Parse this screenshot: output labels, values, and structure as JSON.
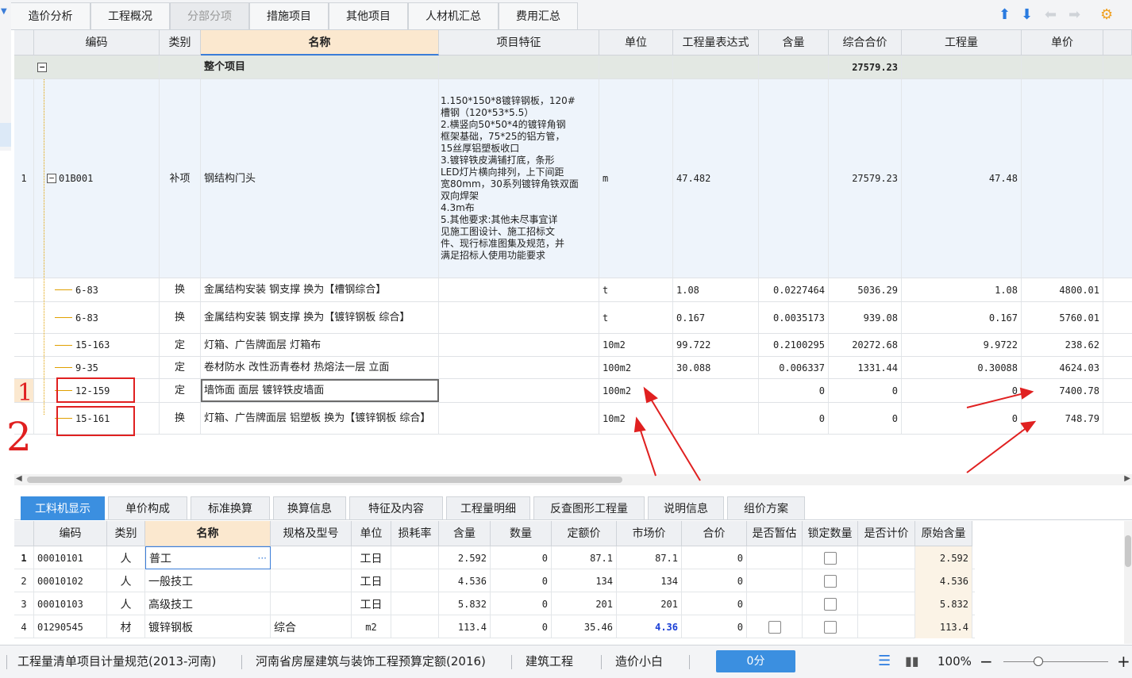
{
  "top_tabs": [
    "造价分析",
    "工程概况",
    "分部分项",
    "措施项目",
    "其他项目",
    "人材机汇总",
    "费用汇总"
  ],
  "active_top_tab": "分部分项",
  "toolbar_icons": [
    "arrow-up-icon",
    "arrow-down-icon",
    "arrow-left-icon",
    "arrow-right-icon",
    "settings-icon"
  ],
  "grid": {
    "headers": [
      "编码",
      "类别",
      "名称",
      "项目特征",
      "单位",
      "工程量表达式",
      "含量",
      "综合合价",
      "工程量",
      "单价"
    ],
    "total_row": {
      "name": "整个项目",
      "combined_total": "27579.23"
    },
    "item_row": {
      "index": "1",
      "code": "01B001",
      "category": "补项",
      "name": "钢结构门头",
      "features": "1.150*150*8镀锌钢板，120#\n槽钢（120*53*5.5）\n2.横竖向50*50*4的镀锌角钢\n框架基础，75*25的铝方管，\n15丝厚铝塑板收口\n3.镀锌铁皮满铺打底，条形\nLED灯片横向排列，上下间距\n宽80mm，30系列镀锌角铁双面\n双向焊架\n4.3m布\n5.其他要求:其他未尽事宜详\n见施工图设计、施工招标文\n件、现行标准图集及规范，并\n满足招标人使用功能要求",
      "unit": "m",
      "expr": "47.482",
      "combined_total": "27579.23",
      "quantity": "47.48"
    },
    "sub_rows": [
      {
        "code": "6-83",
        "category": "换",
        "name": "金属结构安装 钢支撑  换为【槽钢综合】",
        "unit": "t",
        "expr": "1.08",
        "content": "0.0227464",
        "combined_total": "5036.29",
        "quantity": "1.08",
        "price": "4800.01"
      },
      {
        "code": "6-83",
        "category": "换",
        "name": "金属结构安装 钢支撑  换为【镀锌钢板 综合】",
        "unit": "t",
        "expr": "0.167",
        "content": "0.0035173",
        "combined_total": "939.08",
        "quantity": "0.167",
        "price": "5760.01"
      },
      {
        "code": "15-163",
        "category": "定",
        "name": "灯箱、广告牌面层 灯箱布",
        "unit": "10m2",
        "expr": "99.722",
        "content": "0.2100295",
        "combined_total": "20272.68",
        "quantity": "9.9722",
        "price": "238.62"
      },
      {
        "code": "9-35",
        "category": "定",
        "name": "卷材防水 改性沥青卷材 热熔法一层 立面",
        "unit": "100m2",
        "expr": "30.088",
        "content": "0.006337",
        "combined_total": "1331.44",
        "quantity": "0.30088",
        "price": "4624.03"
      },
      {
        "code": "12-159",
        "category": "定",
        "name": "墙饰面 面层 镀锌铁皮墙面",
        "unit": "100m2",
        "expr": "",
        "content": "0",
        "combined_total": "0",
        "quantity": "0",
        "price": "7400.78"
      },
      {
        "code": "15-161",
        "category": "换",
        "name": "灯箱、广告牌面层 铝塑板  换为【镀锌钢板 综合】",
        "unit": "10m2",
        "expr": "",
        "content": "0",
        "combined_total": "0",
        "quantity": "0",
        "price": "748.79"
      }
    ]
  },
  "bottom_tabs": [
    "工料机显示",
    "单价构成",
    "标准换算",
    "换算信息",
    "特征及内容",
    "工程量明细",
    "反查图形工程量",
    "说明信息",
    "组价方案"
  ],
  "active_bottom_tab": "工料机显示",
  "sub_grid": {
    "headers": [
      "编码",
      "类别",
      "名称",
      "规格及型号",
      "单位",
      "损耗率",
      "含量",
      "数量",
      "定额价",
      "市场价",
      "合价",
      "是否暂估",
      "锁定数量",
      "是否计价",
      "原始含量"
    ],
    "rows": [
      {
        "index": "1",
        "code": "00010101",
        "category": "人",
        "name": "普工",
        "spec": "",
        "unit": "工日",
        "loss": "",
        "content": "2.592",
        "qty": "0",
        "quota_price": "87.1",
        "market_price": "87.1",
        "total": "0",
        "orig": "2.592"
      },
      {
        "index": "2",
        "code": "00010102",
        "category": "人",
        "name": "一般技工",
        "spec": "",
        "unit": "工日",
        "loss": "",
        "content": "4.536",
        "qty": "0",
        "quota_price": "134",
        "market_price": "134",
        "total": "0",
        "orig": "4.536"
      },
      {
        "index": "3",
        "code": "00010103",
        "category": "人",
        "name": "高级技工",
        "spec": "",
        "unit": "工日",
        "loss": "",
        "content": "5.832",
        "qty": "0",
        "quota_price": "201",
        "market_price": "201",
        "total": "0",
        "orig": "5.832"
      },
      {
        "index": "4",
        "code": "01290545",
        "category": "材",
        "name": "镀锌钢板",
        "spec": "综合",
        "unit": "m2",
        "loss": "",
        "content": "113.4",
        "qty": "0",
        "quota_price": "35.46",
        "market_price": "4.36",
        "total": "0",
        "orig": "113.4"
      }
    ]
  },
  "status_bar": {
    "spec": "工程量清单项目计量规范(2013-河南)",
    "quota": "河南省房屋建筑与装饰工程预算定额(2016)",
    "profession": "建筑工程",
    "user": "造价小白",
    "score": "0分",
    "zoom": "100%"
  },
  "annotations": [
    "1",
    "2"
  ],
  "colors": {
    "accent": "#3b8fe0",
    "annotation": "#e02020",
    "market_price_highlight": "#1a3fd6"
  }
}
